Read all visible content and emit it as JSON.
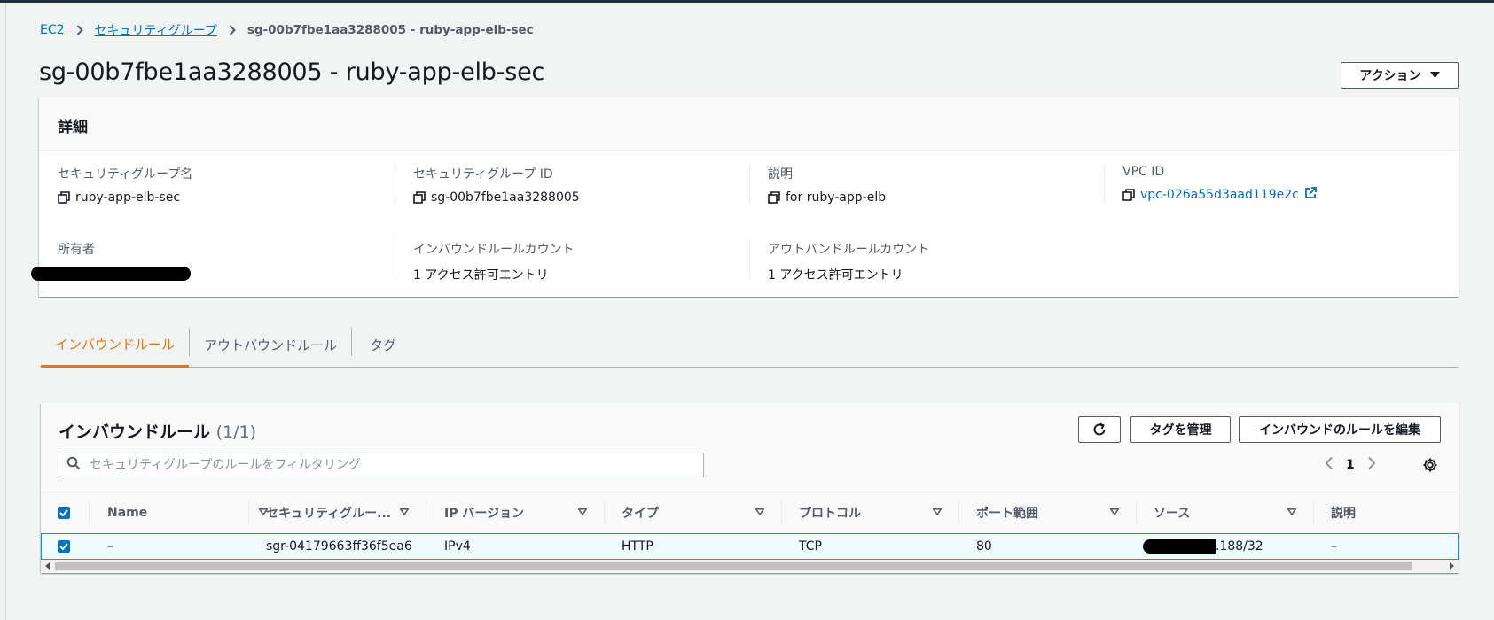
{
  "breadcrumb": {
    "ec2": "EC2",
    "security_groups": "セキュリティグループ",
    "current": "sg-00b7fbe1aa3288005 - ruby-app-elb-sec"
  },
  "page": {
    "title": "sg-00b7fbe1aa3288005 - ruby-app-elb-sec",
    "actions_label": "アクション"
  },
  "details": {
    "heading": "詳細",
    "sg_name_label": "セキュリティグループ名",
    "sg_name": "ruby-app-elb-sec",
    "sg_id_label": "セキュリティグループ ID",
    "sg_id": "sg-00b7fbe1aa3288005",
    "description_label": "説明",
    "description": "for ruby-app-elb",
    "vpc_label": "VPC ID",
    "vpc_id": "vpc-026a55d3aad119e2c",
    "owner_label": "所有者",
    "inbound_count_label": "インバウンドルールカウント",
    "inbound_count": "1 アクセス許可エントリ",
    "outbound_count_label": "アウトバンドルールカウント",
    "outbound_count": "1 アクセス許可エントリ"
  },
  "tabs": [
    {
      "label": "インバウンドルール"
    },
    {
      "label": "アウトバウンドルール"
    },
    {
      "label": "タグ"
    }
  ],
  "rules": {
    "title": "インバウンドルール",
    "count": "(1/1)",
    "manage_tags": "タグを管理",
    "edit_rules": "インバウンドのルールを編集",
    "filter_placeholder": "セキュリティグループのルールをフィルタリング",
    "page_number": "1",
    "columns": [
      "Name",
      "セキュリティグルー...",
      "IP バージョン",
      "タイプ",
      "プロトコル",
      "ポート範囲",
      "ソース",
      "説明"
    ],
    "rows": [
      {
        "name": "–",
        "rule_id": "sgr-04179663ff36f5ea6",
        "ip_version": "IPv4",
        "type": "HTTP",
        "protocol": "TCP",
        "port": "80",
        "source_suffix": ".188/32",
        "description": "–"
      }
    ]
  },
  "colors": {
    "link": "#0073bb",
    "accent_orange": "#ec7211",
    "checkbox": "#0073bb",
    "selected_row": "#f1faff"
  }
}
